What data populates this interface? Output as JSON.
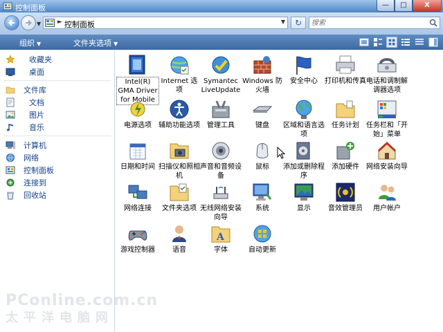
{
  "window": {
    "title": "控制面板",
    "min_label": "—",
    "max_label": "□",
    "close_label": "X"
  },
  "address": {
    "path": "控制面板",
    "search_placeholder": "搜索"
  },
  "toolbar": {
    "organize": "组织",
    "folder_options": "文件夹选项"
  },
  "nav": {
    "favorites": "收藏夹",
    "desktop": "桌面",
    "library": "文件库",
    "documents": "文档",
    "pictures": "图片",
    "music": "音乐",
    "computer": "计算机",
    "network": "网络",
    "control_panel": "控制面板",
    "connect_to": "连接到",
    "recycle_bin": "回收站"
  },
  "items": [
    {
      "label": "Intel(R) GMA Driver for Mobile",
      "icon": "intel-gma-icon",
      "selected": true
    },
    {
      "label": "Internet 选项",
      "icon": "internet-options-icon"
    },
    {
      "label": "Symantec LiveUpdate",
      "icon": "symantec-liveupdate-icon"
    },
    {
      "label": "Windows 防火墙",
      "icon": "firewall-icon"
    },
    {
      "label": "安全中心",
      "icon": "security-center-icon"
    },
    {
      "label": "打印机和传真",
      "icon": "printer-icon"
    },
    {
      "label": "电话和调制解调器选项",
      "icon": "phone-modem-icon"
    },
    {
      "label": "电源选项",
      "icon": "power-options-icon"
    },
    {
      "label": "辅助功能选项",
      "icon": "accessibility-icon"
    },
    {
      "label": "管理工具",
      "icon": "admin-tools-icon"
    },
    {
      "label": "键盘",
      "icon": "keyboard-icon"
    },
    {
      "label": "区域和语言选项",
      "icon": "region-language-icon"
    },
    {
      "label": "任务计划",
      "icon": "scheduled-tasks-icon"
    },
    {
      "label": "任务栏和「开始」菜单",
      "icon": "taskbar-start-icon"
    },
    {
      "label": "日期和时间",
      "icon": "date-time-icon"
    },
    {
      "label": "扫描仪和照相机",
      "icon": "scanner-camera-icon"
    },
    {
      "label": "声音和音频设备",
      "icon": "sound-icon"
    },
    {
      "label": "鼠标",
      "icon": "mouse-icon"
    },
    {
      "label": "添加或删除程序",
      "icon": "add-remove-programs-icon"
    },
    {
      "label": "添加硬件",
      "icon": "add-hardware-icon"
    },
    {
      "label": "网络安装向导",
      "icon": "network-setup-icon"
    },
    {
      "label": "网络连接",
      "icon": "network-connections-icon"
    },
    {
      "label": "文件夹选项",
      "icon": "folder-options-icon"
    },
    {
      "label": "无线网络安装向导",
      "icon": "wireless-setup-icon"
    },
    {
      "label": "系统",
      "icon": "system-icon"
    },
    {
      "label": "显示",
      "icon": "display-icon"
    },
    {
      "label": "音效管理员",
      "icon": "audio-manager-icon"
    },
    {
      "label": "用户帐户",
      "icon": "user-accounts-icon"
    },
    {
      "label": "游戏控制器",
      "icon": "game-controller-icon"
    },
    {
      "label": "语音",
      "icon": "speech-icon"
    },
    {
      "label": "字体",
      "icon": "fonts-icon"
    },
    {
      "label": "自动更新",
      "icon": "auto-update-icon"
    }
  ],
  "watermark": {
    "line1": "PConline.com.cn",
    "line2": "太平洋电脑网"
  }
}
